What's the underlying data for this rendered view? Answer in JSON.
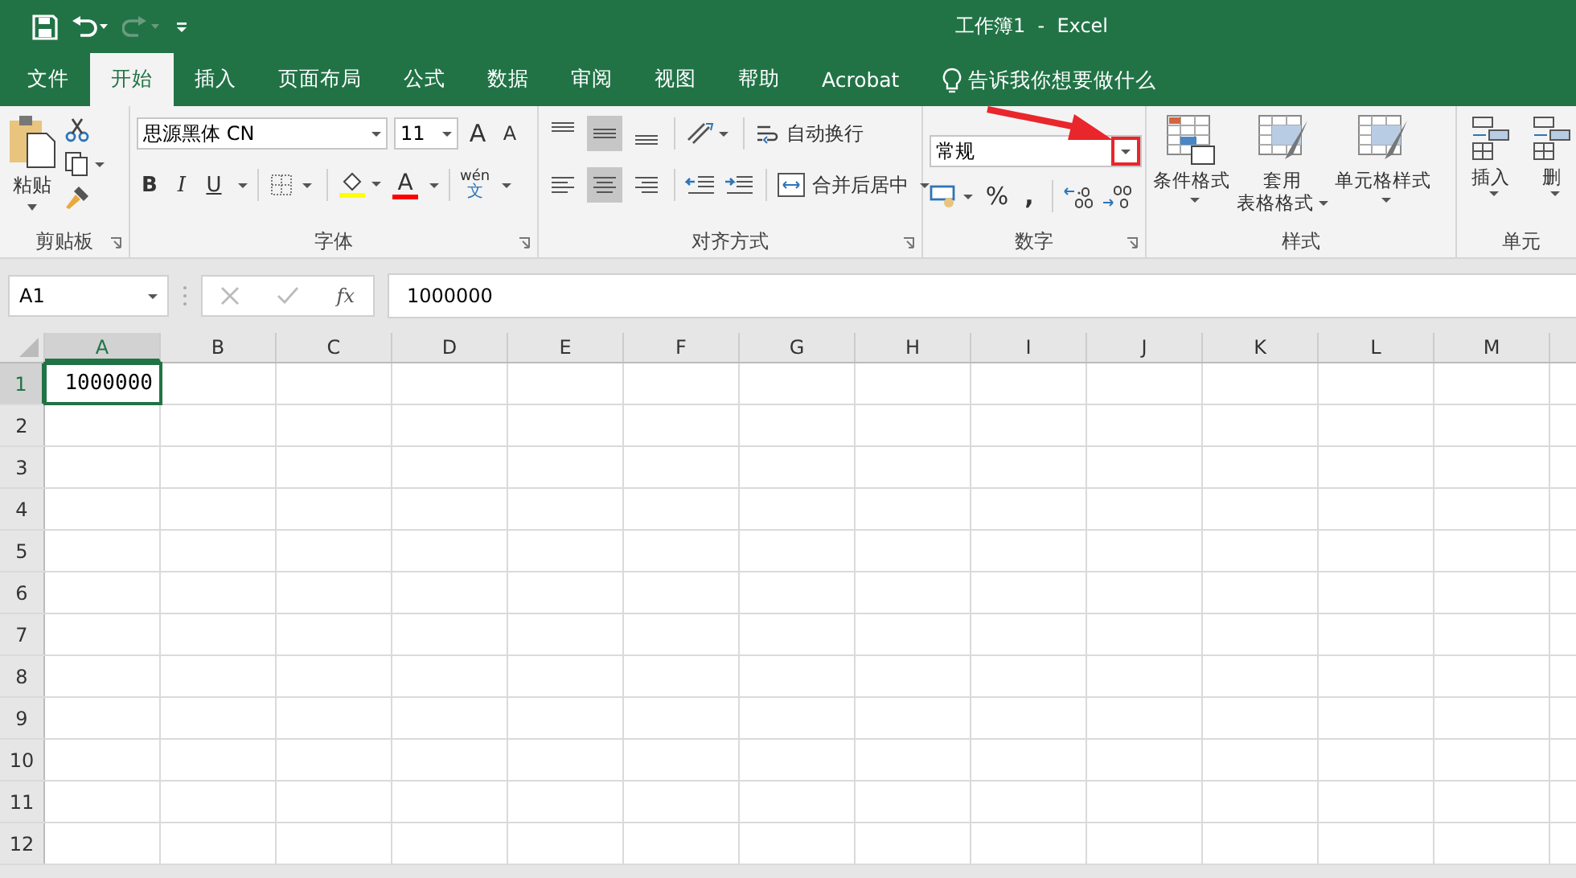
{
  "window": {
    "title": "工作簿1  -  Excel"
  },
  "tabs": [
    {
      "label": "文件",
      "selected": false
    },
    {
      "label": "开始",
      "selected": true
    },
    {
      "label": "插入",
      "selected": false
    },
    {
      "label": "页面布局",
      "selected": false
    },
    {
      "label": "公式",
      "selected": false
    },
    {
      "label": "数据",
      "selected": false
    },
    {
      "label": "审阅",
      "selected": false
    },
    {
      "label": "视图",
      "selected": false
    },
    {
      "label": "帮助",
      "selected": false
    },
    {
      "label": "Acrobat",
      "selected": false
    }
  ],
  "tell_me": {
    "placeholder": "告诉我你想要做什么"
  },
  "ribbon": {
    "clipboard": {
      "paste": "粘贴",
      "label": "剪贴板"
    },
    "font": {
      "font_name": "思源黑体 CN",
      "font_size": "11",
      "grow": "A",
      "shrink": "A",
      "bold": "B",
      "italic": "I",
      "underline": "U",
      "font_color": "A",
      "phonetic_top": "wén",
      "phonetic_bottom": "文",
      "label": "字体"
    },
    "alignment": {
      "vertical": [
        {
          "kind": "top",
          "selected": false
        },
        {
          "kind": "middle",
          "selected": true
        },
        {
          "kind": "bottom",
          "selected": false
        }
      ],
      "horizontal": [
        {
          "kind": "left",
          "selected": false
        },
        {
          "kind": "center",
          "selected": true
        },
        {
          "kind": "right",
          "selected": false
        }
      ],
      "wrap_text": "自动换行",
      "merge_center": "合并后居中",
      "label": "对齐方式"
    },
    "number": {
      "format": "常规",
      "percent": "%",
      "comma": ",",
      "label": "数字"
    },
    "styles": {
      "buttons": [
        {
          "lines": [
            "条件格式"
          ]
        },
        {
          "lines": [
            "套用",
            "表格格式"
          ]
        },
        {
          "lines": [
            "单元格样式"
          ]
        }
      ],
      "label": "样式"
    },
    "cells": {
      "buttons": [
        "插入",
        "删"
      ],
      "label": "单元"
    }
  },
  "formula_bar": {
    "name_box": "A1",
    "fx": "fx",
    "value": "1000000"
  },
  "sheet": {
    "columns": [
      {
        "label": "A",
        "selected": true
      },
      {
        "label": "B",
        "selected": false
      },
      {
        "label": "C",
        "selected": false
      },
      {
        "label": "D",
        "selected": false
      },
      {
        "label": "E",
        "selected": false
      },
      {
        "label": "F",
        "selected": false
      },
      {
        "label": "G",
        "selected": false
      },
      {
        "label": "H",
        "selected": false
      },
      {
        "label": "I",
        "selected": false
      },
      {
        "label": "J",
        "selected": false
      },
      {
        "label": "K",
        "selected": false
      },
      {
        "label": "L",
        "selected": false
      },
      {
        "label": "M",
        "selected": false
      }
    ],
    "rows": [
      {
        "label": "1",
        "selected": true,
        "cells": [
          "1000000"
        ]
      },
      {
        "label": "2",
        "selected": false,
        "cells": []
      },
      {
        "label": "3",
        "selected": false,
        "cells": []
      },
      {
        "label": "4",
        "selected": false,
        "cells": []
      },
      {
        "label": "5",
        "selected": false,
        "cells": []
      },
      {
        "label": "6",
        "selected": false,
        "cells": []
      },
      {
        "label": "7",
        "selected": false,
        "cells": []
      },
      {
        "label": "8",
        "selected": false,
        "cells": []
      },
      {
        "label": "9",
        "selected": false,
        "cells": []
      },
      {
        "label": "10",
        "selected": false,
        "cells": []
      },
      {
        "label": "11",
        "selected": false,
        "cells": []
      },
      {
        "label": "12",
        "selected": false,
        "cells": []
      }
    ]
  }
}
